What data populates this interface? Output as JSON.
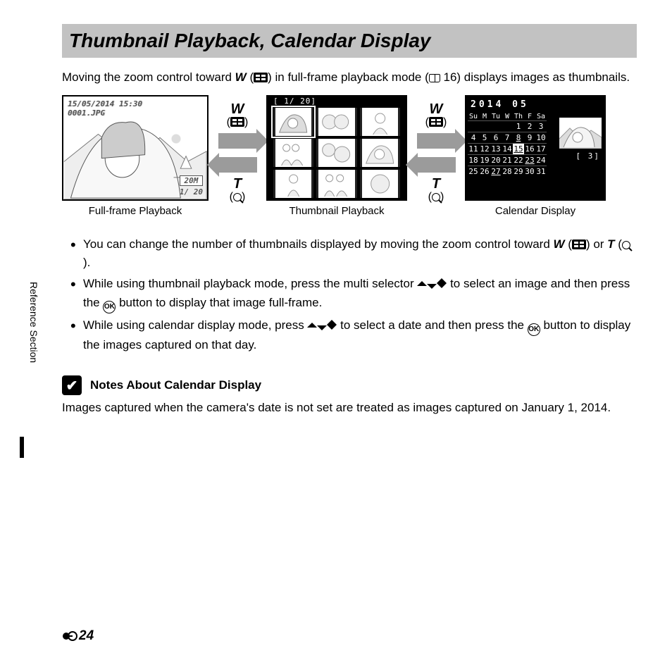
{
  "title": "Thumbnail Playback, Calendar Display",
  "intro_a": "Moving the zoom control toward ",
  "intro_b": " in full-frame playback mode (",
  "intro_page": "16",
  "intro_c": ") displays images as thumbnails.",
  "fullframe": {
    "caption": "Full-frame Playback",
    "date": "15/05/2014 15:30",
    "file": "0001.JPG",
    "size": "20M",
    "counter": "1/   20"
  },
  "zoom": {
    "w": "W",
    "t": "T"
  },
  "thumbnail": {
    "caption": "Thumbnail Playback",
    "counter": "[   1/  20]"
  },
  "calendar": {
    "caption": "Calendar Display",
    "title": "2014  05",
    "days": [
      "Su",
      "M",
      "Tu",
      "W",
      "Th",
      "F",
      "Sa"
    ],
    "rows": [
      [
        "",
        "",
        "",
        "",
        "1",
        "2",
        "3"
      ],
      [
        "4",
        "5",
        "6",
        "7",
        "8",
        "9",
        "10"
      ],
      [
        "11",
        "12",
        "13",
        "14",
        "15",
        "16",
        "17"
      ],
      [
        "18",
        "19",
        "20",
        "21",
        "22",
        "23",
        "24"
      ],
      [
        "25",
        "26",
        "27",
        "28",
        "29",
        "30",
        "31"
      ]
    ],
    "selected": "15",
    "underlined": [
      "8",
      "15",
      "23",
      "27"
    ],
    "count": "[    3]"
  },
  "bullets": {
    "b1a": "You can change the number of thumbnails displayed by moving the zoom control toward ",
    "b1b": " or ",
    "b2a": "While using thumbnail playback mode, press the multi selector ",
    "b2b": " to select an image and then press the ",
    "b2c": " button to display that image full-frame.",
    "b3a": "While using calendar display mode, press ",
    "b3b": " to select a date and then press the ",
    "b3c": " button to display the images captured on that day."
  },
  "notes": {
    "heading": "Notes About Calendar Display",
    "body": "Images captured when the camera's date is not set are treated as images captured on January 1, 2014."
  },
  "ok_label": "OK",
  "side_label": "Reference Section",
  "page_num": "24"
}
